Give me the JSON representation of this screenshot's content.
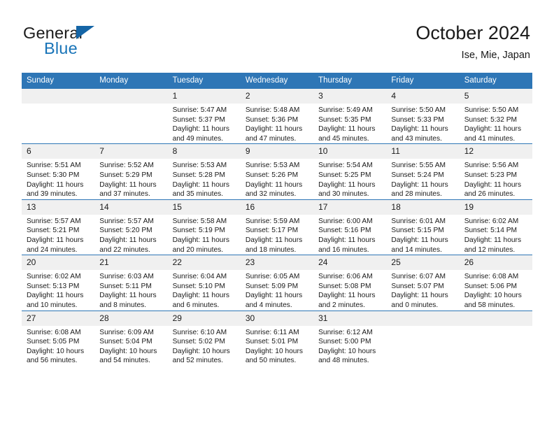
{
  "brand": {
    "name_part1": "General",
    "name_part2": "Blue",
    "triangle_color": "#1565a6",
    "blue_color": "#1874b8"
  },
  "header": {
    "title": "October 2024",
    "subtitle": "Ise, Mie, Japan"
  },
  "theme": {
    "header_bg": "#2e76b6",
    "daynum_bg": "#f0f0f0",
    "row_line": "#2e76b6"
  },
  "weekday_headers": [
    "Sunday",
    "Monday",
    "Tuesday",
    "Wednesday",
    "Thursday",
    "Friday",
    "Saturday"
  ],
  "weeks": [
    [
      {
        "day": "",
        "sunrise": "",
        "sunset": "",
        "daylight": ""
      },
      {
        "day": "",
        "sunrise": "",
        "sunset": "",
        "daylight": ""
      },
      {
        "day": "1",
        "sunrise": "Sunrise: 5:47 AM",
        "sunset": "Sunset: 5:37 PM",
        "daylight": "Daylight: 11 hours and 49 minutes."
      },
      {
        "day": "2",
        "sunrise": "Sunrise: 5:48 AM",
        "sunset": "Sunset: 5:36 PM",
        "daylight": "Daylight: 11 hours and 47 minutes."
      },
      {
        "day": "3",
        "sunrise": "Sunrise: 5:49 AM",
        "sunset": "Sunset: 5:35 PM",
        "daylight": "Daylight: 11 hours and 45 minutes."
      },
      {
        "day": "4",
        "sunrise": "Sunrise: 5:50 AM",
        "sunset": "Sunset: 5:33 PM",
        "daylight": "Daylight: 11 hours and 43 minutes."
      },
      {
        "day": "5",
        "sunrise": "Sunrise: 5:50 AM",
        "sunset": "Sunset: 5:32 PM",
        "daylight": "Daylight: 11 hours and 41 minutes."
      }
    ],
    [
      {
        "day": "6",
        "sunrise": "Sunrise: 5:51 AM",
        "sunset": "Sunset: 5:30 PM",
        "daylight": "Daylight: 11 hours and 39 minutes."
      },
      {
        "day": "7",
        "sunrise": "Sunrise: 5:52 AM",
        "sunset": "Sunset: 5:29 PM",
        "daylight": "Daylight: 11 hours and 37 minutes."
      },
      {
        "day": "8",
        "sunrise": "Sunrise: 5:53 AM",
        "sunset": "Sunset: 5:28 PM",
        "daylight": "Daylight: 11 hours and 35 minutes."
      },
      {
        "day": "9",
        "sunrise": "Sunrise: 5:53 AM",
        "sunset": "Sunset: 5:26 PM",
        "daylight": "Daylight: 11 hours and 32 minutes."
      },
      {
        "day": "10",
        "sunrise": "Sunrise: 5:54 AM",
        "sunset": "Sunset: 5:25 PM",
        "daylight": "Daylight: 11 hours and 30 minutes."
      },
      {
        "day": "11",
        "sunrise": "Sunrise: 5:55 AM",
        "sunset": "Sunset: 5:24 PM",
        "daylight": "Daylight: 11 hours and 28 minutes."
      },
      {
        "day": "12",
        "sunrise": "Sunrise: 5:56 AM",
        "sunset": "Sunset: 5:23 PM",
        "daylight": "Daylight: 11 hours and 26 minutes."
      }
    ],
    [
      {
        "day": "13",
        "sunrise": "Sunrise: 5:57 AM",
        "sunset": "Sunset: 5:21 PM",
        "daylight": "Daylight: 11 hours and 24 minutes."
      },
      {
        "day": "14",
        "sunrise": "Sunrise: 5:57 AM",
        "sunset": "Sunset: 5:20 PM",
        "daylight": "Daylight: 11 hours and 22 minutes."
      },
      {
        "day": "15",
        "sunrise": "Sunrise: 5:58 AM",
        "sunset": "Sunset: 5:19 PM",
        "daylight": "Daylight: 11 hours and 20 minutes."
      },
      {
        "day": "16",
        "sunrise": "Sunrise: 5:59 AM",
        "sunset": "Sunset: 5:17 PM",
        "daylight": "Daylight: 11 hours and 18 minutes."
      },
      {
        "day": "17",
        "sunrise": "Sunrise: 6:00 AM",
        "sunset": "Sunset: 5:16 PM",
        "daylight": "Daylight: 11 hours and 16 minutes."
      },
      {
        "day": "18",
        "sunrise": "Sunrise: 6:01 AM",
        "sunset": "Sunset: 5:15 PM",
        "daylight": "Daylight: 11 hours and 14 minutes."
      },
      {
        "day": "19",
        "sunrise": "Sunrise: 6:02 AM",
        "sunset": "Sunset: 5:14 PM",
        "daylight": "Daylight: 11 hours and 12 minutes."
      }
    ],
    [
      {
        "day": "20",
        "sunrise": "Sunrise: 6:02 AM",
        "sunset": "Sunset: 5:13 PM",
        "daylight": "Daylight: 11 hours and 10 minutes."
      },
      {
        "day": "21",
        "sunrise": "Sunrise: 6:03 AM",
        "sunset": "Sunset: 5:11 PM",
        "daylight": "Daylight: 11 hours and 8 minutes."
      },
      {
        "day": "22",
        "sunrise": "Sunrise: 6:04 AM",
        "sunset": "Sunset: 5:10 PM",
        "daylight": "Daylight: 11 hours and 6 minutes."
      },
      {
        "day": "23",
        "sunrise": "Sunrise: 6:05 AM",
        "sunset": "Sunset: 5:09 PM",
        "daylight": "Daylight: 11 hours and 4 minutes."
      },
      {
        "day": "24",
        "sunrise": "Sunrise: 6:06 AM",
        "sunset": "Sunset: 5:08 PM",
        "daylight": "Daylight: 11 hours and 2 minutes."
      },
      {
        "day": "25",
        "sunrise": "Sunrise: 6:07 AM",
        "sunset": "Sunset: 5:07 PM",
        "daylight": "Daylight: 11 hours and 0 minutes."
      },
      {
        "day": "26",
        "sunrise": "Sunrise: 6:08 AM",
        "sunset": "Sunset: 5:06 PM",
        "daylight": "Daylight: 10 hours and 58 minutes."
      }
    ],
    [
      {
        "day": "27",
        "sunrise": "Sunrise: 6:08 AM",
        "sunset": "Sunset: 5:05 PM",
        "daylight": "Daylight: 10 hours and 56 minutes."
      },
      {
        "day": "28",
        "sunrise": "Sunrise: 6:09 AM",
        "sunset": "Sunset: 5:04 PM",
        "daylight": "Daylight: 10 hours and 54 minutes."
      },
      {
        "day": "29",
        "sunrise": "Sunrise: 6:10 AM",
        "sunset": "Sunset: 5:02 PM",
        "daylight": "Daylight: 10 hours and 52 minutes."
      },
      {
        "day": "30",
        "sunrise": "Sunrise: 6:11 AM",
        "sunset": "Sunset: 5:01 PM",
        "daylight": "Daylight: 10 hours and 50 minutes."
      },
      {
        "day": "31",
        "sunrise": "Sunrise: 6:12 AM",
        "sunset": "Sunset: 5:00 PM",
        "daylight": "Daylight: 10 hours and 48 minutes."
      },
      {
        "day": "",
        "sunrise": "",
        "sunset": "",
        "daylight": ""
      },
      {
        "day": "",
        "sunrise": "",
        "sunset": "",
        "daylight": ""
      }
    ]
  ]
}
